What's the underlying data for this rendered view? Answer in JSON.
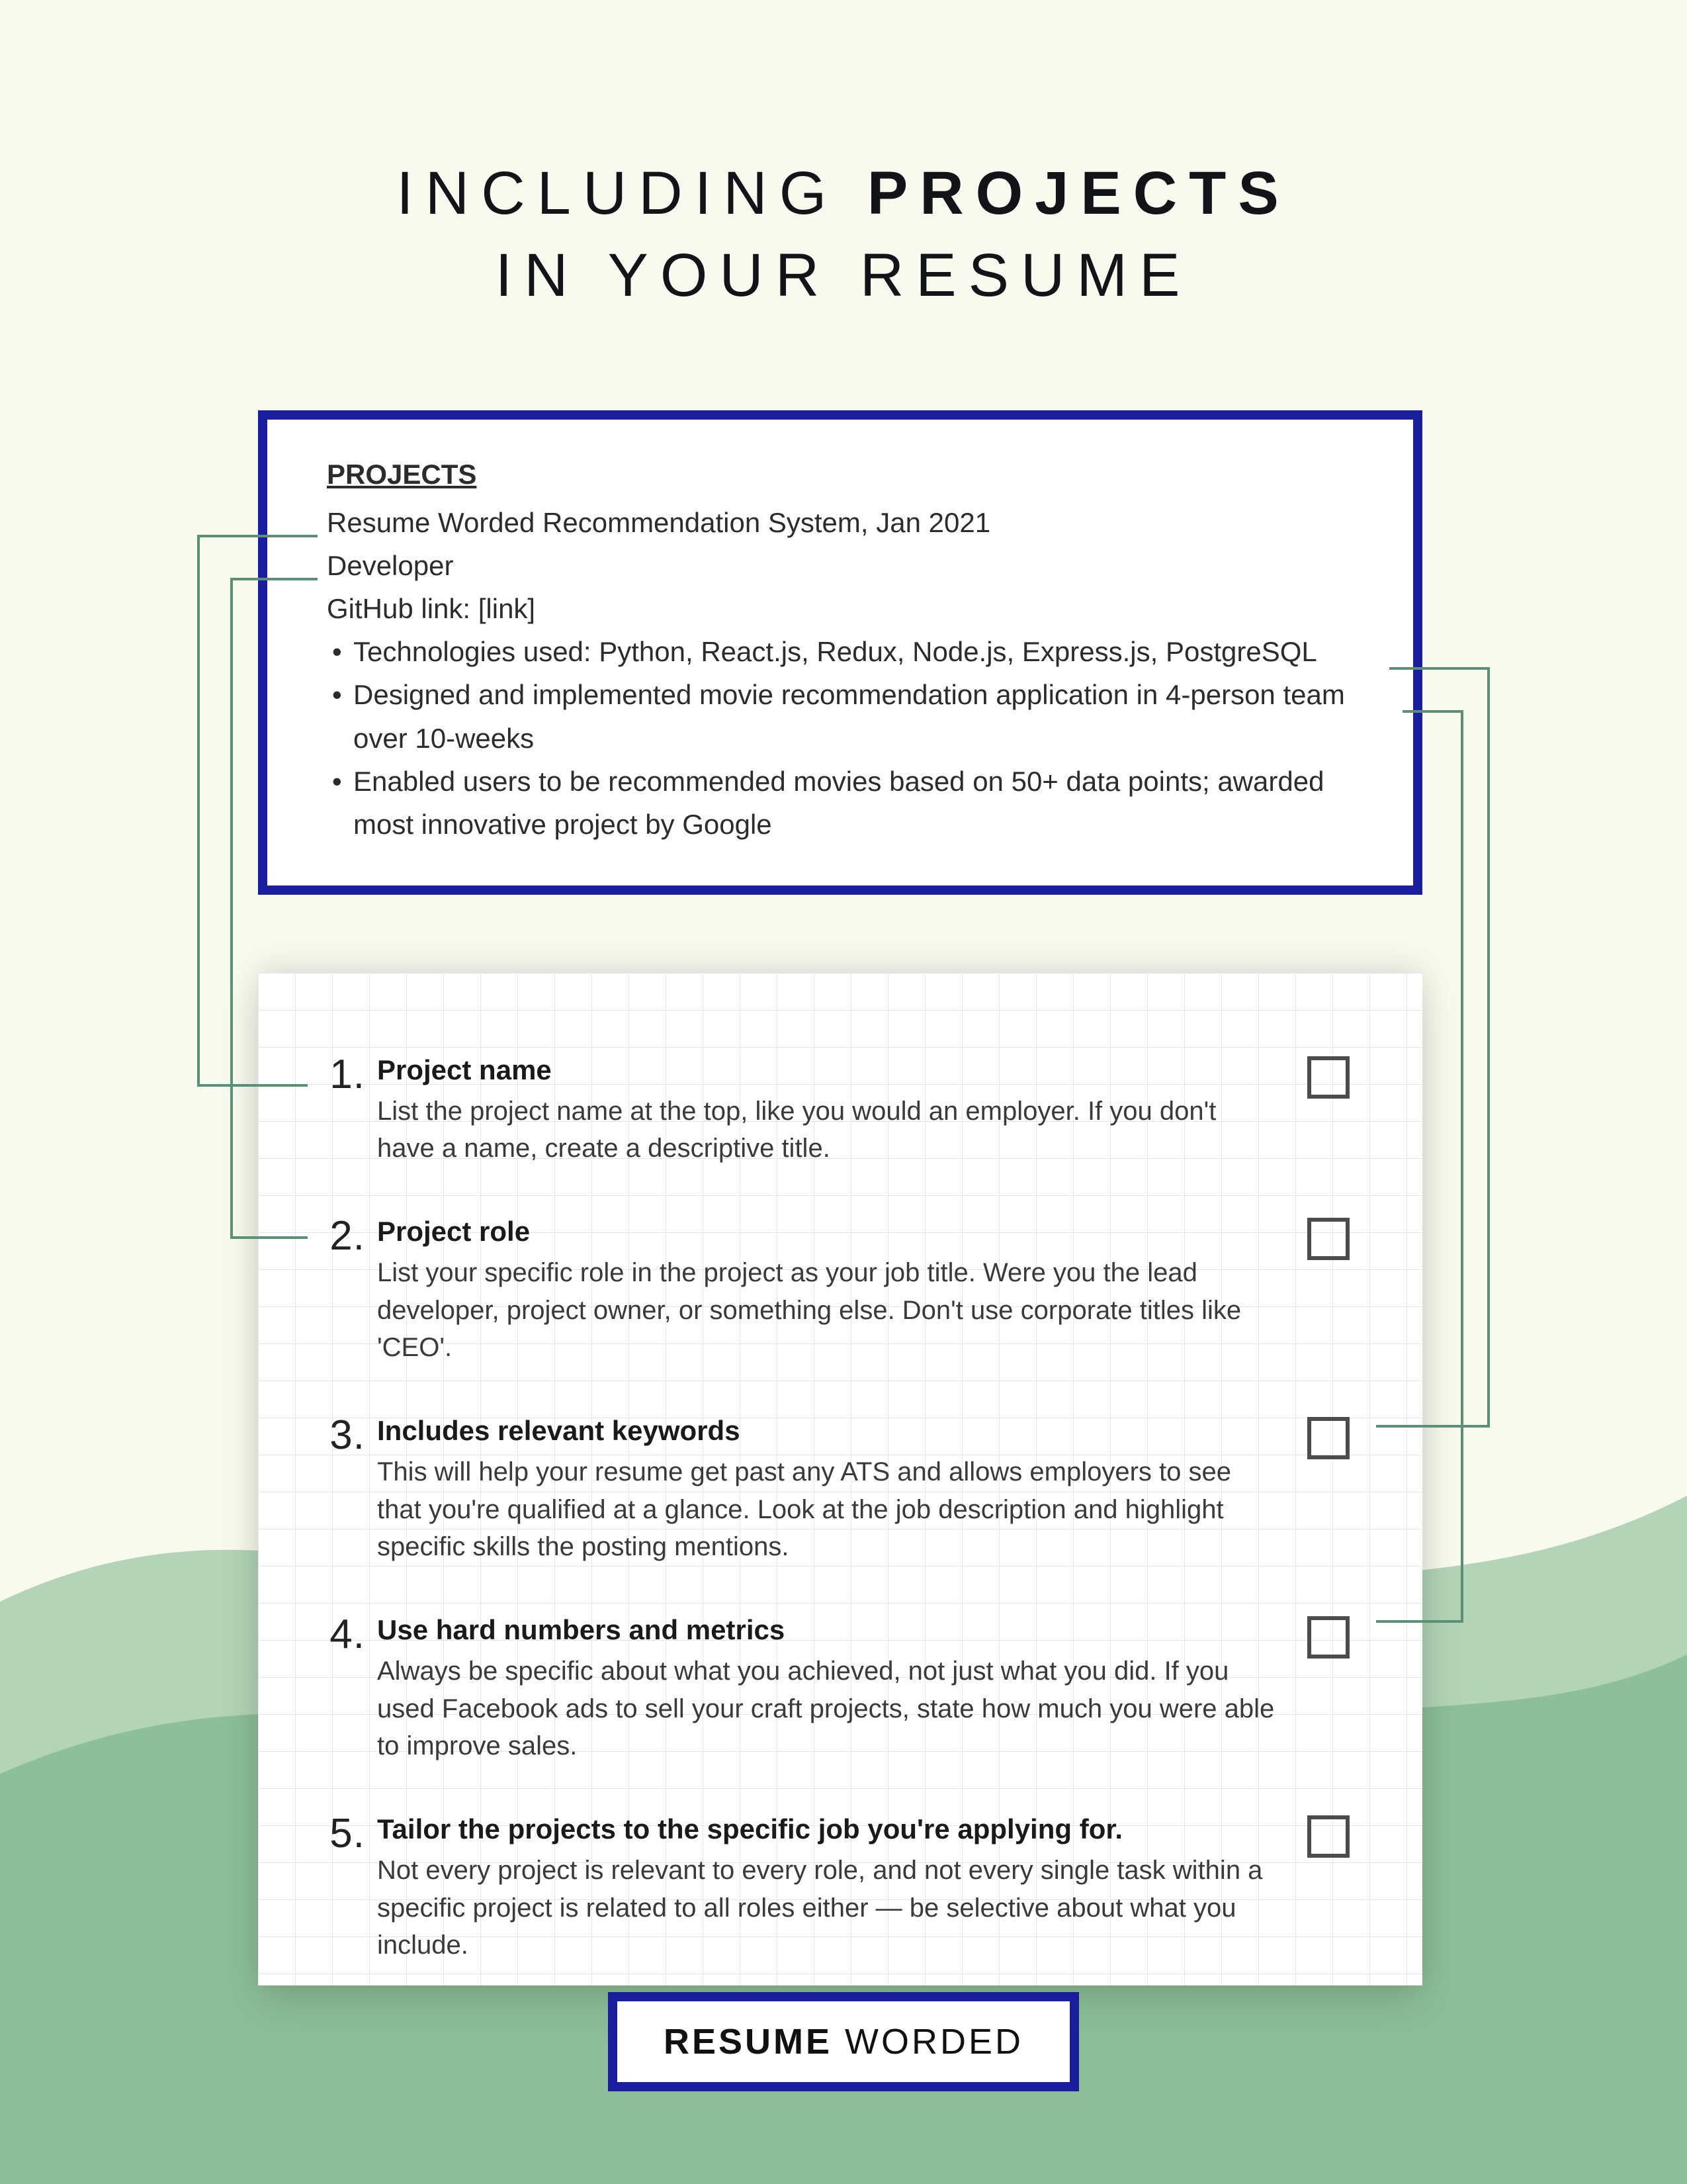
{
  "title": {
    "line1_a": "INCLUDING ",
    "line1_b": "PROJECTS",
    "line2": "IN YOUR RESUME"
  },
  "example": {
    "section_label": "PROJECTS",
    "name": "Resume Worded Recommendation System, Jan 2021",
    "role": "Developer",
    "github": "GitHub link: [link]",
    "bullets": [
      "Technologies used: Python, React.js, Redux, Node.js, Express.js, PostgreSQL",
      "Designed and implemented movie recommendation application in 4-person team over 10-weeks",
      "Enabled users to be recommended movies based on 50+ data points; awarded most innovative project by Google"
    ]
  },
  "checklist": [
    {
      "num": "1.",
      "title": "Project name",
      "desc": "List the project name at the top, like you would an employer. If you don't have a name, create a descriptive title."
    },
    {
      "num": "2.",
      "title": "Project role",
      "desc": "List your specific role in the project as your job title. Were you the lead developer, project owner, or something else. Don't use corporate titles like 'CEO'."
    },
    {
      "num": "3.",
      "title": "Includes relevant keywords",
      "desc": "This will help your resume get past any ATS and allows employers to see that you're qualified at a glance. Look at the job description and highlight specific skills the posting mentions."
    },
    {
      "num": "4.",
      "title": "Use hard numbers and metrics",
      "desc": "Always be specific about what you achieved, not just what you did. If you used Facebook ads to sell your craft projects, state how much you were able to improve sales."
    },
    {
      "num": "5.",
      "title": "Tailor the projects to the specific job you're applying for.",
      "desc": "Not every project is relevant to every role, and not every single task within a specific project is related to all roles either — be selective about what you include."
    }
  ],
  "footer": {
    "word1": "RESUME",
    "word2": " WORDED"
  },
  "colors": {
    "accent_blue": "#1b1e9c",
    "connector": "#5a9075",
    "wave_light": "#b3d4b6",
    "wave_dark": "#8dbf9a"
  }
}
